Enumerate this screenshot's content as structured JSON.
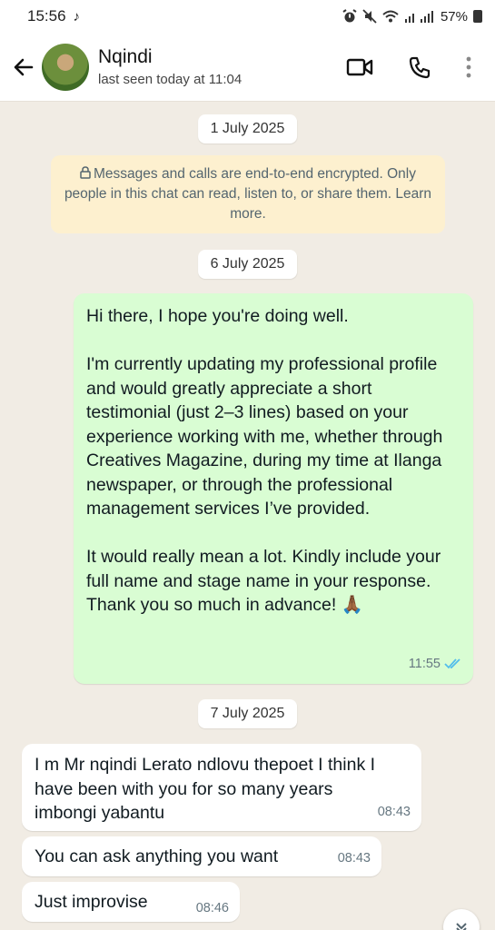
{
  "status_bar": {
    "time": "15:56",
    "battery": "57%",
    "icons": [
      "tiktok-icon",
      "alarm-icon",
      "mute-icon",
      "wifi-icon",
      "signal-icon",
      "battery-icon"
    ]
  },
  "header": {
    "contact_name": "Nqindi",
    "last_seen": "last seen today at 11:04",
    "icons": [
      "back-arrow-icon",
      "video-call-icon",
      "phone-icon",
      "more-vert-icon"
    ]
  },
  "chat": {
    "date_1": "1 July 2025",
    "encryption_notice": "Messages and calls are end-to-end encrypted. Only people in this chat can read, listen to, or share them. Learn more.",
    "date_2": "6 July 2025",
    "outgoing_message": {
      "text": "Hi there, I hope you're doing well.\n\nI'm currently updating my professional profile and would greatly appreciate a short testimonial (just 2–3 lines) based on your experience working with me, whether through Creatives Magazine, during my time at Ilanga newspaper, or through the professional management services I’ve provided.\n\nIt would really mean a lot. Kindly include your full name and stage name in your response. Thank you so much in advance! 🙏🏾",
      "time": "11:55"
    },
    "date_3": "7 July 2025",
    "incoming_messages": [
      {
        "text": "I m Mr nqindi Lerato ndlovu thepoet I think I have been with you for so many years imbongi yabantu",
        "time": "08:43"
      },
      {
        "text": "You can ask anything you want",
        "time": "08:43"
      },
      {
        "text": "Just improvise",
        "time": "08:46"
      }
    ]
  },
  "colors": {
    "outgoing_bubble": "#d9fdd3",
    "incoming_bubble": "#ffffff",
    "chat_background": "#f1ece4",
    "encryption_notice_bg": "#fdf0cf",
    "read_ticks": "#53bdeb"
  }
}
